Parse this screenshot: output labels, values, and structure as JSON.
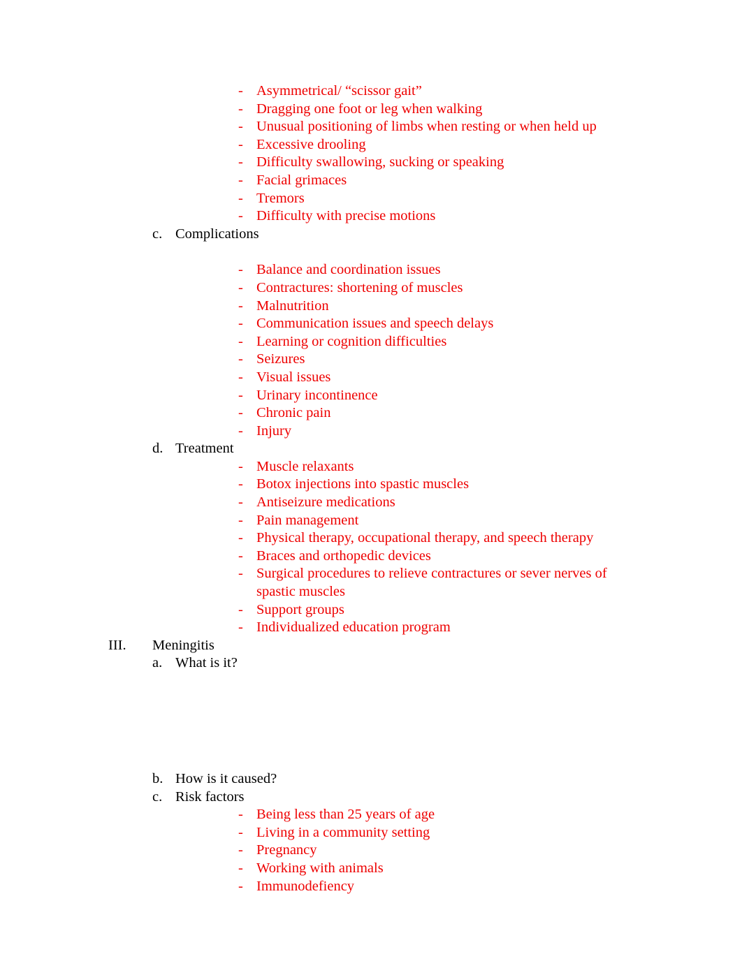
{
  "document": {
    "blocks": [
      {
        "kind": "dash",
        "text": "Asymmetrical/ “scissor gait”"
      },
      {
        "kind": "dash",
        "text": "Dragging one foot or leg when walking"
      },
      {
        "kind": "dash",
        "text": "Unusual positioning of limbs when resting or when held up"
      },
      {
        "kind": "dash",
        "text": "Excessive drooling"
      },
      {
        "kind": "dash",
        "text": "Difficulty swallowing, sucking or speaking"
      },
      {
        "kind": "dash",
        "text": "Facial grimaces"
      },
      {
        "kind": "dash",
        "text": "Tremors"
      },
      {
        "kind": "dash",
        "text": "Difficulty with precise motions"
      },
      {
        "kind": "letter",
        "marker": "c.",
        "text": "Complications"
      },
      {
        "kind": "gap",
        "size": "md"
      },
      {
        "kind": "dash",
        "text": "Balance and coordination issues"
      },
      {
        "kind": "dash",
        "text": "Contractures: shortening of muscles"
      },
      {
        "kind": "dash",
        "text": "Malnutrition"
      },
      {
        "kind": "dash",
        "text": "Communication issues and speech delays"
      },
      {
        "kind": "dash",
        "text": "Learning or cognition difficulties"
      },
      {
        "kind": "dash",
        "text": "Seizures"
      },
      {
        "kind": "dash",
        "text": "Visual issues"
      },
      {
        "kind": "dash",
        "text": "Urinary incontinence"
      },
      {
        "kind": "dash",
        "text": "Chronic pain"
      },
      {
        "kind": "dash",
        "text": "Injury"
      },
      {
        "kind": "letter",
        "marker": "d.",
        "text": "Treatment"
      },
      {
        "kind": "dash",
        "text": "Muscle relaxants"
      },
      {
        "kind": "dash",
        "text": "Botox injections into spastic muscles"
      },
      {
        "kind": "dash",
        "text": "Antiseizure medications"
      },
      {
        "kind": "dash",
        "text": "Pain management"
      },
      {
        "kind": "dash",
        "text": "Physical therapy, occupational therapy, and speech therapy"
      },
      {
        "kind": "dash",
        "text": "Braces and orthopedic devices"
      },
      {
        "kind": "dash",
        "text": "Surgical procedures to relieve contractures or sever nerves of spastic muscles"
      },
      {
        "kind": "dash",
        "text": "Support groups"
      },
      {
        "kind": "dash",
        "text": "Individualized education program"
      },
      {
        "kind": "roman",
        "marker": "III.",
        "text": "Meningitis"
      },
      {
        "kind": "letter",
        "marker": "a.",
        "text": "What is it?"
      },
      {
        "kind": "gap",
        "size": "lg"
      },
      {
        "kind": "letter",
        "marker": "b.",
        "text": "How is it caused?"
      },
      {
        "kind": "letter",
        "marker": "c.",
        "text": "Risk factors"
      },
      {
        "kind": "dash",
        "text": "Being less than 25 years of age"
      },
      {
        "kind": "dash",
        "text": "Living in a community setting"
      },
      {
        "kind": "dash",
        "text": "Pregnancy"
      },
      {
        "kind": "dash",
        "text": "Working with animals"
      },
      {
        "kind": "dash",
        "text": "Immunodefiency"
      }
    ],
    "dash_marker": "-",
    "colors": {
      "body_text": "#000000",
      "bullet_text": "#ee0000"
    }
  }
}
